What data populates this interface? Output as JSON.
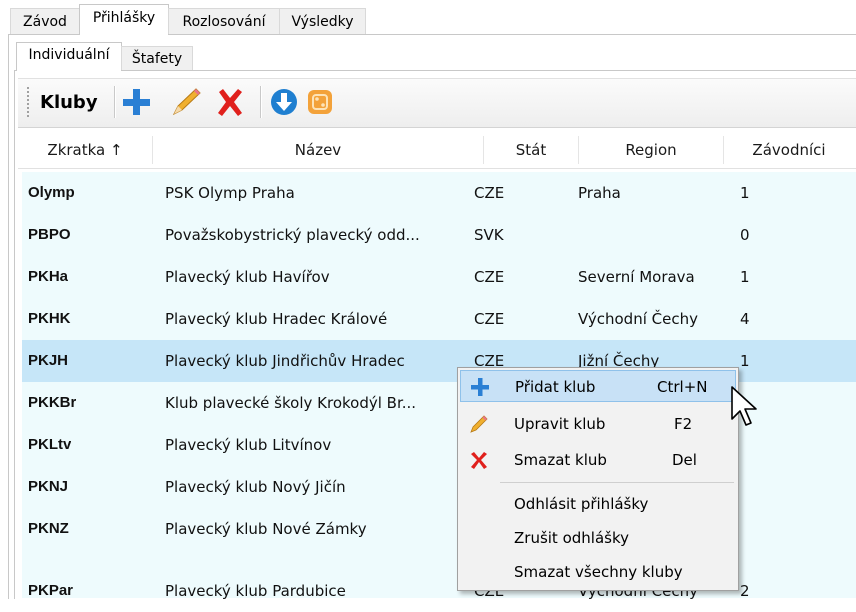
{
  "main_tabs": [
    {
      "label": "Závod"
    },
    {
      "label": "Přihlášky",
      "active": true
    },
    {
      "label": "Rozlosování"
    },
    {
      "label": "Výsledky"
    }
  ],
  "sub_tabs": [
    {
      "label": "Individuální",
      "active": true
    },
    {
      "label": "Štafety"
    }
  ],
  "toolbar": {
    "title": "Kluby",
    "icons": [
      "add-icon",
      "edit-icon",
      "delete-icon",
      "download-icon",
      "pattern-icon"
    ]
  },
  "grid": {
    "columns": [
      "Zkratka ↑",
      "Název",
      "Stát",
      "Region",
      "Závodníci"
    ],
    "rows": [
      {
        "code": "Olymp",
        "name": "PSK Olymp Praha",
        "state": "CZE",
        "region": "Praha",
        "count": "1"
      },
      {
        "code": "PBPO",
        "name": "Považskobystrický plavecký odd...",
        "state": "SVK",
        "region": "",
        "count": "0"
      },
      {
        "code": "PKHa",
        "name": "Plavecký klub Havířov",
        "state": "CZE",
        "region": "Severní Morava",
        "count": "1"
      },
      {
        "code": "PKHK",
        "name": "Plavecký klub Hradec Králové",
        "state": "CZE",
        "region": "Východní Čechy",
        "count": "4"
      },
      {
        "code": "PKJH",
        "name": "Plavecký klub Jindřichův Hradec",
        "state": "CZE",
        "region": "Jižní Čechy",
        "count": "1",
        "selected": true
      },
      {
        "code": "PKKBr",
        "name": "Klub plavecké školy Krokodýl Br...",
        "state": "",
        "region": "",
        "count": ""
      },
      {
        "code": "PKLtv",
        "name": "Plavecký klub Litvínov",
        "state": "",
        "region": "",
        "count": ""
      },
      {
        "code": "PKNJ",
        "name": "Plavecký klub Nový Jičín",
        "state": "",
        "region": "",
        "count": ""
      },
      {
        "code": "PKNZ",
        "name": "Plavecký klub Nové Zámky",
        "state": "",
        "region": "",
        "count": ""
      },
      {
        "code": "PKPar",
        "name": "Plavecký klub Pardubice",
        "state": "CZE",
        "region": "Východní Čechy",
        "count": "2"
      }
    ]
  },
  "context_menu": {
    "items": [
      {
        "label": "Přidat klub",
        "shortcut": "Ctrl+N",
        "icon": "add-icon",
        "highlighted": true
      },
      {
        "label": "Upravit klub",
        "shortcut": "F2",
        "icon": "edit-icon"
      },
      {
        "label": "Smazat klub",
        "shortcut": "Del",
        "icon": "delete-icon"
      },
      {
        "label": "Odhlásit přihlášky",
        "shortcut": ""
      },
      {
        "label": "Zrušit odhlášky",
        "shortcut": ""
      },
      {
        "label": "Smazat všechny kluby",
        "shortcut": ""
      }
    ]
  },
  "colors": {
    "row_bg": "#eefbfd",
    "row_selected": "#c6e6f8",
    "menu_highlight": "#c8e1f6",
    "add_blue": "#2a7fd4",
    "delete_red": "#e0201c"
  }
}
